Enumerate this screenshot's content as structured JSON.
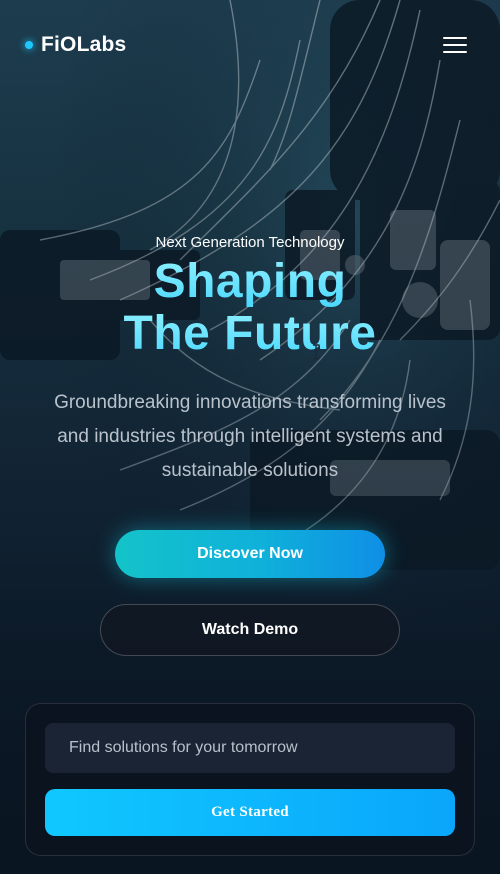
{
  "brand": {
    "name": "FiOLabs",
    "accent_color": "#1ec8ff"
  },
  "header": {
    "menu_icon": "hamburger-menu-icon"
  },
  "hero": {
    "eyebrow": "Next Generation Technology",
    "headline_line1": "Shaping",
    "headline_line2": "The Future",
    "subtext": "Groundbreaking innovations transforming lives and industries through intelligent systems and sustainable solutions",
    "background": "robotic-machinery-with-cables"
  },
  "actions": {
    "primary_label": "Discover Now",
    "secondary_label": "Watch Demo"
  },
  "search_card": {
    "placeholder": "Find solutions for your tomorrow",
    "value": "",
    "submit_label": "Get Started"
  },
  "colors": {
    "primary_gradient_start": "#14c3c9",
    "primary_gradient_end": "#0f8fe6",
    "cta_blue": "#10c8ff",
    "headline_cyan": "#4ad8ff"
  }
}
